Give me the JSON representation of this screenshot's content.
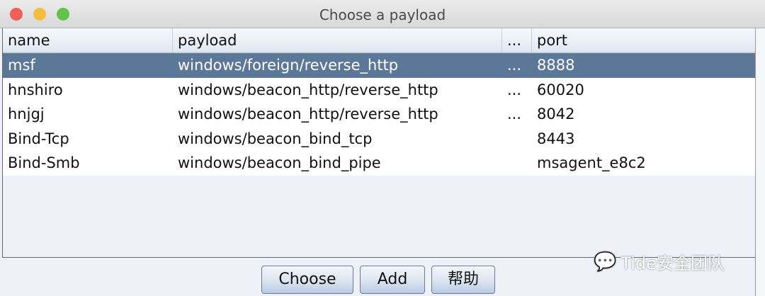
{
  "window": {
    "title": "Choose a payload"
  },
  "table": {
    "columns": [
      "name",
      "payload",
      "...",
      "port"
    ],
    "rows": [
      {
        "name": "msf",
        "payload": "windows/foreign/reverse_http",
        "more": "...",
        "port": "8888",
        "selected": true
      },
      {
        "name": "hnshiro",
        "payload": "windows/beacon_http/reverse_http",
        "more": "...",
        "port": "60020"
      },
      {
        "name": "hnjgj",
        "payload": "windows/beacon_http/reverse_http",
        "more": "...",
        "port": "8042"
      },
      {
        "name": "Bind-Tcp",
        "payload": "windows/beacon_bind_tcp",
        "more": "",
        "port": "8443"
      },
      {
        "name": "Bind-Smb",
        "payload": "windows/beacon_bind_pipe",
        "more": "",
        "port": "msagent_e8c2"
      }
    ]
  },
  "buttons": {
    "choose": "Choose",
    "add": "Add",
    "help": "帮助"
  },
  "watermark": "Tide安全团队",
  "colors": {
    "selection": "#5c7898"
  }
}
